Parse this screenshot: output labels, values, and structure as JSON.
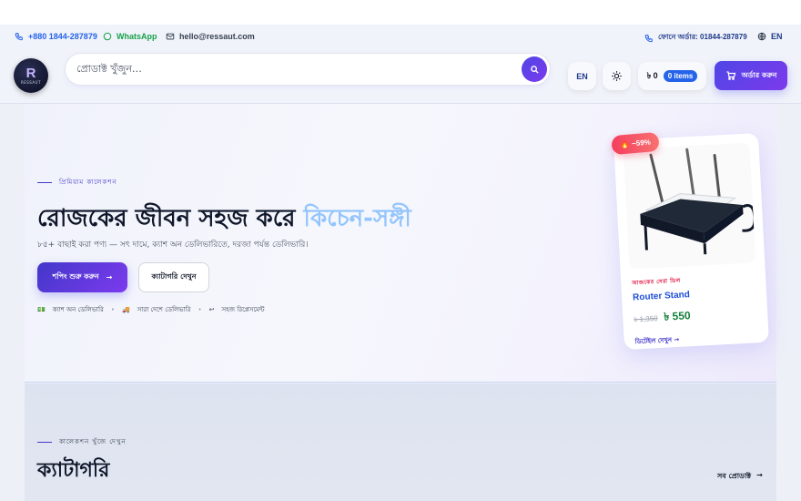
{
  "topbar": {
    "phone": "+880 1844-287879",
    "whatsapp": "WhatsApp",
    "email": "hello@ressaut.com",
    "order_phone": "ফোনে অর্ডার: 01844-287879",
    "language": "EN"
  },
  "header": {
    "logo_letter": "R",
    "logo_text": "RESSAUT",
    "search_placeholder": "প্রোডাক্ট খুঁজুন…",
    "lang_button": "EN",
    "cart_total": "৳ 0",
    "cart_items": "0 items",
    "order_button": "অর্ডার করুন"
  },
  "hero": {
    "eyebrow": "প্রিমিয়াম কালেকশন",
    "title_main": "রোজকের জীবন সহজ করে ",
    "title_accent": "কিচেন-সঙ্গী",
    "subtitle": "৮৫+ বাছাই করা পণ্য — সৎ দামে, ক্যাশ অন ডেলিভারিতে, দরজা পর্যন্ত ডেলিভারি।",
    "primary_button": "শপিং শুরু করুন",
    "primary_arrow": "→",
    "secondary_button": "ক্যাটাগরি দেখুন",
    "features": [
      {
        "icon": "💵",
        "label": "ক্যাশ অন ডেলিভারি"
      },
      {
        "icon": "🚚",
        "label": "সারা দেশে ডেলিভারি"
      },
      {
        "icon": "↩",
        "label": "সহজ রিপ্লেসমেন্ট"
      }
    ]
  },
  "product_card": {
    "discount": "−59%",
    "deal_label": "আজকের সেরা ডিল",
    "name": "Router Stand",
    "old_price": "৳ 1,350",
    "new_price": "৳ 550",
    "view_link": "ডিটেইল দেখুন",
    "view_arrow": "→"
  },
  "categories": {
    "eyebrow": "কালেকশন খুঁজে দেখুন",
    "title": "ক্যাটাগরি",
    "view_all": "সব প্রোডাক্ট",
    "view_all_arrow": "→"
  },
  "colors": {
    "accent": "#4f46e5",
    "accent2": "#7c3aed",
    "whatsapp": "#16a34a",
    "sale": "#f43f5e",
    "price": "#15803d"
  }
}
